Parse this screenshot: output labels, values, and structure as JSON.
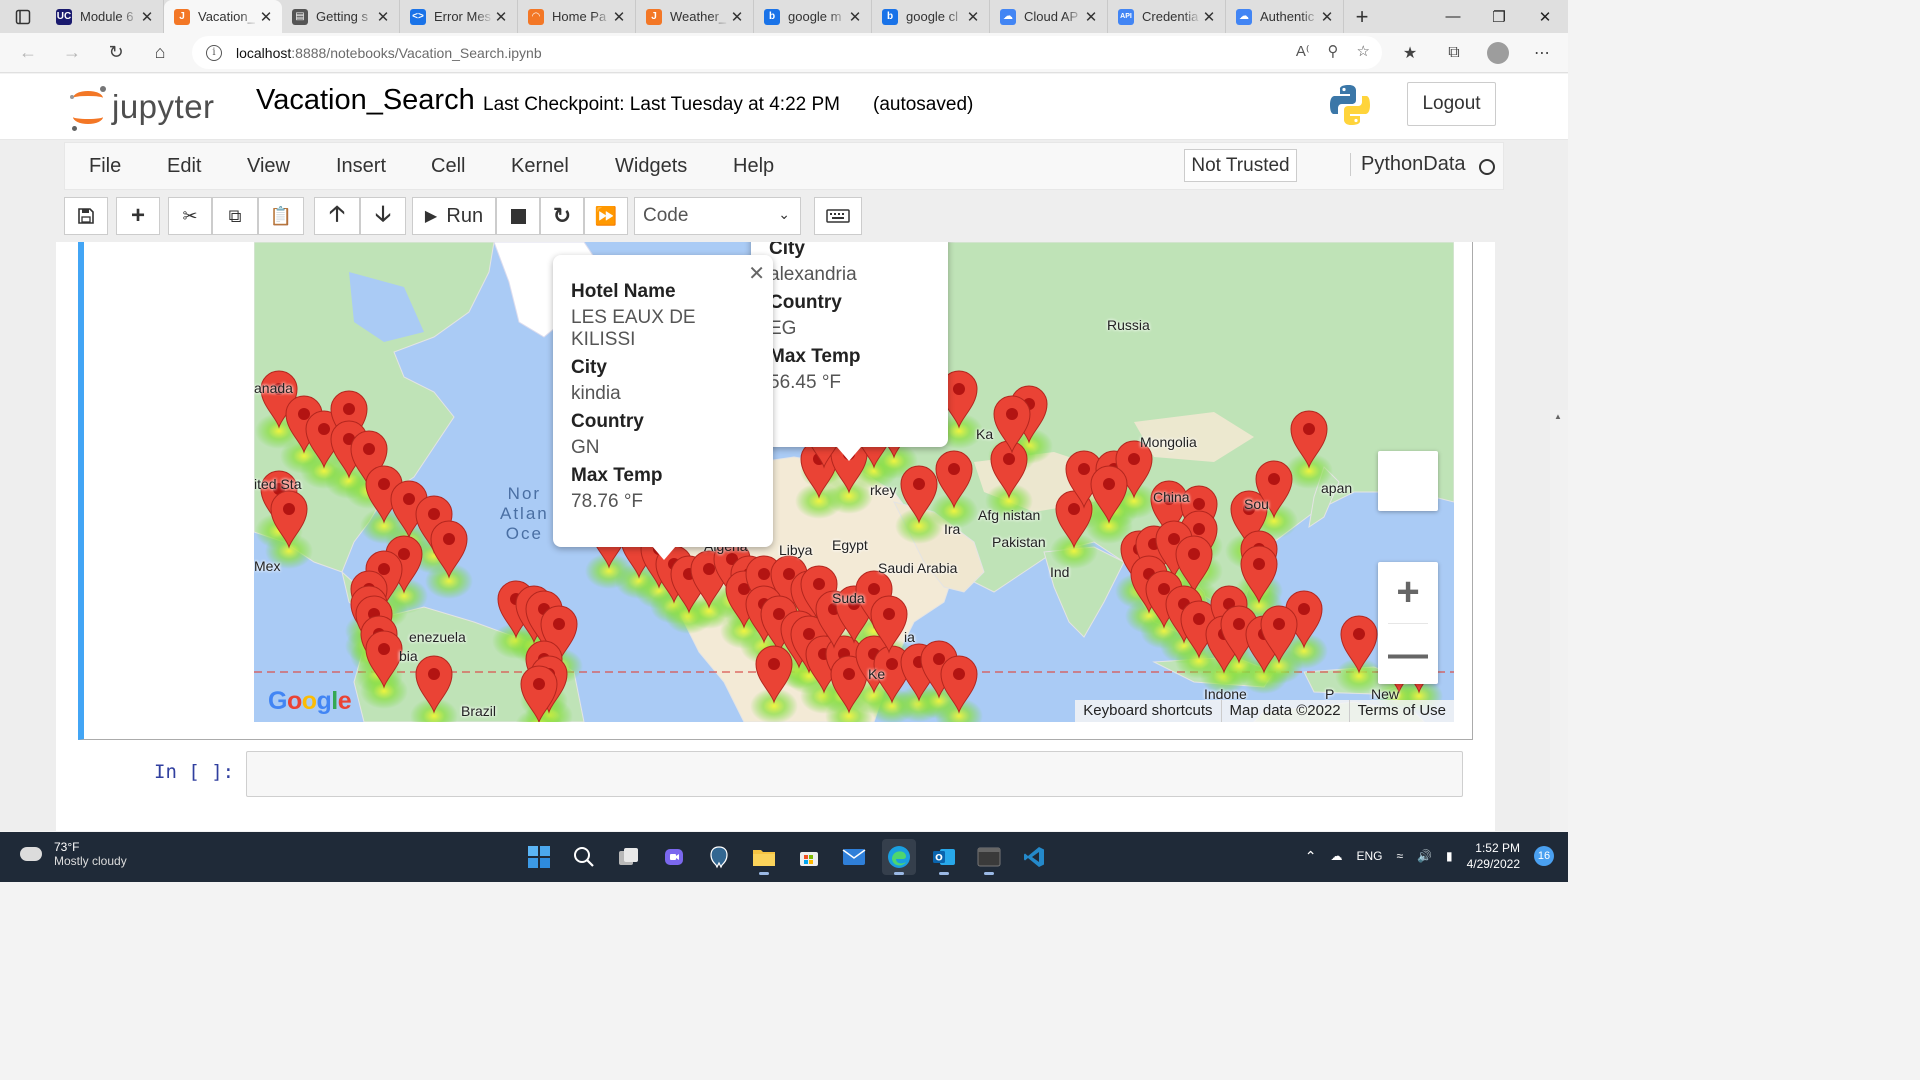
{
  "browser": {
    "tabs": [
      {
        "title": "Module 6",
        "favicon_color": "#1a1a6e",
        "favicon_text": "UC"
      },
      {
        "title": "Vacation_",
        "favicon_color": "#f37726",
        "favicon_text": "J",
        "active": true
      },
      {
        "title": "Getting s",
        "favicon_color": "#555555",
        "favicon_text": "▤"
      },
      {
        "title": "Error Mes",
        "favicon_color": "#1a73e8",
        "favicon_text": "<>"
      },
      {
        "title": "Home Pa",
        "favicon_color": "#f37726",
        "favicon_text": "◠"
      },
      {
        "title": "Weather_",
        "favicon_color": "#f37726",
        "favicon_text": "J"
      },
      {
        "title": "google m",
        "favicon_color": "#1a73e8",
        "favicon_text": "b"
      },
      {
        "title": "google cl",
        "favicon_color": "#1a73e8",
        "favicon_text": "b"
      },
      {
        "title": "Cloud AP",
        "favicon_color": "#4285f4",
        "favicon_text": "☁"
      },
      {
        "title": "Credentia",
        "favicon_color": "#4285f4",
        "favicon_text": "API"
      },
      {
        "title": "Authentic",
        "favicon_color": "#4285f4",
        "favicon_text": "☁"
      }
    ],
    "url_host": "localhost",
    "url_path": ":8888/notebooks/Vacation_Search.ipynb"
  },
  "jupyter": {
    "logo_text": "jupyter",
    "notebook_title": "Vacation_Search",
    "checkpoint": "Last Checkpoint: Last Tuesday at 4:22 PM",
    "autosave": "(autosaved)",
    "logout": "Logout",
    "menu": [
      "File",
      "Edit",
      "View",
      "Insert",
      "Cell",
      "Kernel",
      "Widgets",
      "Help"
    ],
    "trust_status": "Not Trusted",
    "kernel": "PythonData",
    "run_label": "Run",
    "cell_type": "Code",
    "prompt": "In [ ]:"
  },
  "map": {
    "labels": {
      "russia": "Russia",
      "mongolia": "Mongolia",
      "china": "China",
      "japan": "apan",
      "canada": "anada",
      "us": "ited Sta",
      "mexico": "Mex",
      "venezuela": "enezuela",
      "colombia": "bia",
      "brazil": "Brazil",
      "libya": "Libya",
      "egypt": "Egypt",
      "algeria": "Algeria",
      "saudi": "Saudi Arabia",
      "turkey": "rkey",
      "afghanistan": "Afg  nistan",
      "pakistan": "Pakistan",
      "iran": "Ira",
      "india": "Ind",
      "sudan": "Suda",
      "kazakh": "Ka",
      "south_korea": "Sou",
      "png": "P",
      "new": "New",
      "ethiopia": "ia",
      "kenya": "Ke",
      "indonesia": "Indone",
      "ocean_1": "Nor",
      "ocean_2": "Atlan",
      "ocean_3": "Oce"
    },
    "popup_1": {
      "fields": [
        {
          "label": "Hotel Name",
          "value": "LES EAUX DE KILISSI"
        },
        {
          "label": "City",
          "value": "kindia"
        },
        {
          "label": "Country",
          "value": "GN"
        },
        {
          "label": "Max Temp",
          "value": "78.76 °F"
        }
      ]
    },
    "popup_2": {
      "fields": [
        {
          "label": "City",
          "value": "alexandria"
        },
        {
          "label": "Country",
          "value": "EG"
        },
        {
          "label": "Max Temp",
          "value": "56.45 °F"
        }
      ]
    },
    "google_text": "Google",
    "footer": [
      "Keyboard shortcuts",
      "Map data ©2022",
      "Terms of Use"
    ]
  },
  "taskbar": {
    "temperature": "73°F",
    "condition": "Mostly cloudy",
    "language": "ENG",
    "time": "1:52 PM",
    "date": "4/29/2022",
    "notifications": "16"
  }
}
